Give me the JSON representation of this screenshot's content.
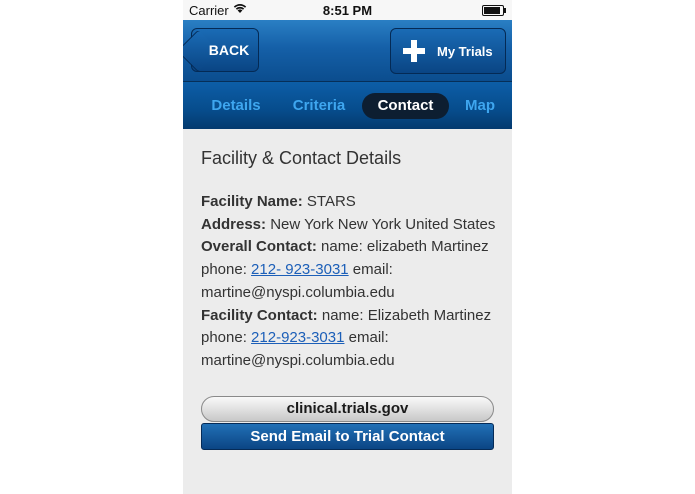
{
  "status_bar": {
    "carrier": "Carrier",
    "time": "8:51 PM",
    "wifi_icon": "wifi-icon",
    "battery_icon": "battery-icon"
  },
  "navbar": {
    "back_label": "BACK",
    "my_trials_label": "My Trials",
    "my_trials_icon": "plus-icon"
  },
  "tabs": [
    {
      "label": "Details",
      "active": false
    },
    {
      "label": "Criteria",
      "active": false
    },
    {
      "label": "Contact",
      "active": true
    },
    {
      "label": "Map",
      "active": false
    }
  ],
  "content": {
    "title": "Facility & Contact Details",
    "facility_name_label": "Facility Name:",
    "facility_name": " STARS",
    "address_label": "Address:",
    "address": " New York New York  United States",
    "overall_contact_label": "Overall Contact:",
    "overall_contact_text_1": " name: elizabeth Martinez phone: ",
    "overall_contact_phone": "212- 923-3031",
    "overall_contact_text_2": " email: martine@nyspi.columbia.edu",
    "facility_contact_label": "Facility Contact:",
    "facility_contact_text_1": " name: Elizabeth Martinez phone: ",
    "facility_contact_phone": "212-923-3031",
    "facility_contact_text_2": " email: martine@nyspi.columbia.edu"
  },
  "buttons": {
    "clinical_trials": "clinical.trials.gov",
    "send_email": "Send Email to Trial Contact"
  },
  "colors": {
    "navbar_blue": "#1560a8",
    "tab_inactive": "#3ea6ef",
    "tab_active_bg": "#0d1e31",
    "link": "#1c5fb8",
    "content_bg": "#ececec"
  }
}
